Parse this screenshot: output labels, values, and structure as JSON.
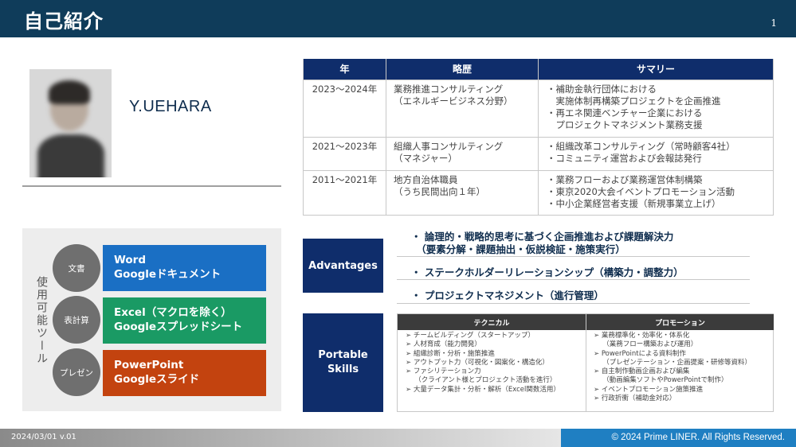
{
  "header": {
    "title": "自己紹介",
    "page_number": "1"
  },
  "profile": {
    "name": "Y.UEHARA"
  },
  "history": {
    "headers": [
      "年",
      "略歴",
      "サマリー"
    ],
    "rows": [
      {
        "year": "2023〜2024年",
        "career": "業務推進コンサルティング\n（エネルギービジネス分野）",
        "summary": "・補助金執行団体における\n　実施体制再構築プロジェクトを企画推進\n・再エネ関連ベンチャー企業における\n　プロジェクトマネジメント業務支援"
      },
      {
        "year": "2021〜2023年",
        "career": "組織人事コンサルティング\n（マネジャー）",
        "summary": "・組織改革コンサルティング（常時顧客4社）\n・コミュニティ運営および会報誌発行"
      },
      {
        "year": "2011〜2021年",
        "career": "地方自治体職員\n（うち民間出向１年）",
        "summary": "・業務フローおよび業務運営体制構築\n・東京2020大会イベントプロモーション活動\n・中小企業経営者支援（新規事業立上げ）"
      }
    ]
  },
  "tools": {
    "vertical_label": "使用可能ツール",
    "items": [
      {
        "category": "文書",
        "apps": "Word\nGoogleドキュメント",
        "color": "#1a6fc4"
      },
      {
        "category": "表計算",
        "apps": "Excel（マクロを除く）\nGoogleスプレッドシート",
        "color": "#1a9a64"
      },
      {
        "category": "プレゼン",
        "apps": "PowerPoint\nGoogleスライド",
        "color": "#c3430f"
      }
    ]
  },
  "advantages": {
    "label": "Advantages",
    "items": [
      "・ 論理的・戦略的思考に基づく企画推進および課題解決力\n　（要素分解・課題抽出・仮説検証・施策実行）",
      "・ ステークホルダーリレーションシップ（構築力・調整力）",
      "・ プロジェクトマネジメント（進行管理）"
    ]
  },
  "portable_skills": {
    "label": "Portable\nSkills",
    "technical_header": "テクニカル",
    "promotion_header": "プロモーション",
    "technical": "➢ チームビルディング（スタートアップ）\n➢ 人材育成（能力開発）\n➢ 組織診断・分析・施策推進\n➢ アウトプット力（可視化・図案化・構造化）\n➢ ファシリテーション力\n　 （クライアント様とプロジェクト活動を進行）\n➢ 大量データ集計・分析・解析（Excel関数活用）",
    "promotion": "➢ 業務標準化・効率化・体系化\n　 （業務フロー構築および運用）\n➢ PowerPointによる資料制作\n　 （プレゼンテーション・企画提案・研修等資料）\n➢ 自主制作動画企画および編集\n　 （動画編集ソフトやPowerPointで制作）\n➢ イベントプロモーション施策推進\n➢ 行政折衝（補助金対応）"
  },
  "footer": {
    "version": "2024/03/01 v.01",
    "copyright": "© 2024  Prime LINER. All Rights Reserved."
  }
}
